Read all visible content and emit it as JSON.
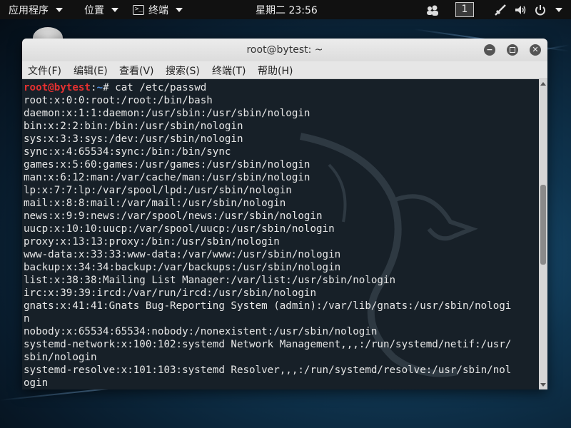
{
  "topbar": {
    "applications": "应用程序",
    "places": "位置",
    "terminal": "终端",
    "clock": "星期二 23:56",
    "workspace": "1",
    "icons": [
      "people-icon",
      "network-icon",
      "volume-icon",
      "power-icon"
    ]
  },
  "window": {
    "title": "root@bytest: ~",
    "menu": [
      "文件(F)",
      "编辑(E)",
      "查看(V)",
      "搜索(S)",
      "终端(T)",
      "帮助(H)"
    ],
    "prompt": {
      "user": "root@bytest",
      "sep": ":",
      "path": "~",
      "symbol": "# ",
      "command": "cat /etc/passwd"
    },
    "lines": [
      "root:x:0:0:root:/root:/bin/bash",
      "daemon:x:1:1:daemon:/usr/sbin:/usr/sbin/nologin",
      "bin:x:2:2:bin:/bin:/usr/sbin/nologin",
      "sys:x:3:3:sys:/dev:/usr/sbin/nologin",
      "sync:x:4:65534:sync:/bin:/bin/sync",
      "games:x:5:60:games:/usr/games:/usr/sbin/nologin",
      "man:x:6:12:man:/var/cache/man:/usr/sbin/nologin",
      "lp:x:7:7:lp:/var/spool/lpd:/usr/sbin/nologin",
      "mail:x:8:8:mail:/var/mail:/usr/sbin/nologin",
      "news:x:9:9:news:/var/spool/news:/usr/sbin/nologin",
      "uucp:x:10:10:uucp:/var/spool/uucp:/usr/sbin/nologin",
      "proxy:x:13:13:proxy:/bin:/usr/sbin/nologin",
      "www-data:x:33:33:www-data:/var/www:/usr/sbin/nologin",
      "backup:x:34:34:backup:/var/backups:/usr/sbin/nologin",
      "list:x:38:38:Mailing List Manager:/var/list:/usr/sbin/nologin",
      "irc:x:39:39:ircd:/var/run/ircd:/usr/sbin/nologin",
      "gnats:x:41:41:Gnats Bug-Reporting System (admin):/var/lib/gnats:/usr/sbin/nologi",
      "n",
      "nobody:x:65534:65534:nobody:/nonexistent:/usr/sbin/nologin",
      "systemd-network:x:100:102:systemd Network Management,,,:/run/systemd/netif:/usr/",
      "sbin/nologin",
      "systemd-resolve:x:101:103:systemd Resolver,,,:/run/systemd/resolve:/usr/sbin/nol",
      "ogin"
    ]
  },
  "colors": {
    "prompt_user": "#e63030",
    "prompt_path": "#4d8fe0",
    "terminal_bg": "#162028"
  }
}
